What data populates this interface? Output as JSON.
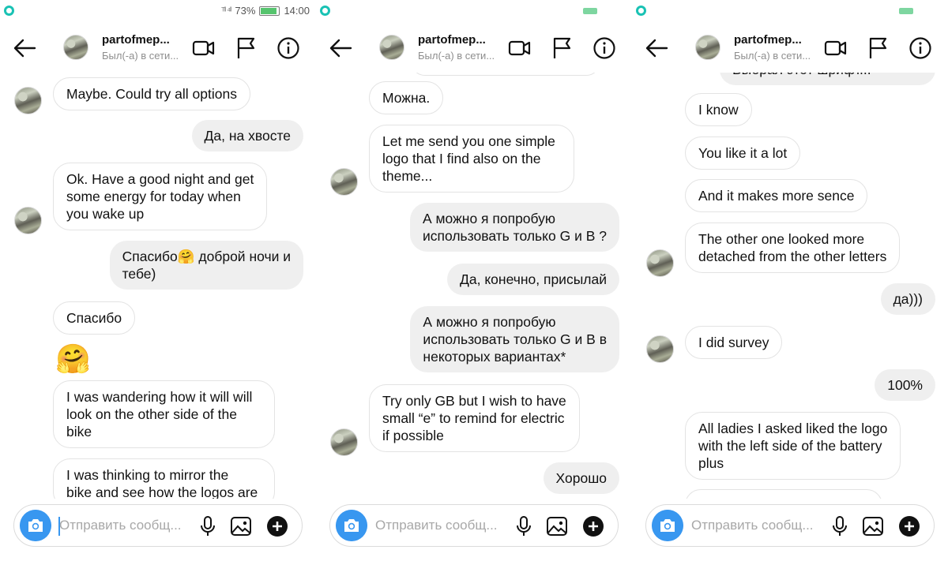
{
  "status": {
    "battery_pct": "73%",
    "time": "14:00"
  },
  "header": {
    "name": "partofmep...",
    "status": "Был(-а) в сети..."
  },
  "composer": {
    "placeholder": "Отправить сообщ..."
  },
  "panel1": {
    "messages": [
      {
        "text": "Maybe. Could try all options"
      },
      {
        "text": "Да, на хвосте"
      },
      {
        "text": "Ok. Have a good night and get\nsome energy for today when\nyou wake up"
      },
      {
        "text": "Спасибо🤗 доброй ночи и\nтебе)"
      },
      {
        "text": "Спасибо"
      },
      {
        "text": "🤗"
      },
      {
        "text": "I was wandering how it will will\nlook on the other side of the\nbike"
      },
      {
        "text": "I was thinking to mirror the\nbike and see how the logos are"
      }
    ]
  },
  "panel2": {
    "messages": [
      {
        "text": "Можна."
      },
      {
        "text": "Let me send you one simple\nlogo that I find also on the\ntheme..."
      },
      {
        "text": "А можно я попробую\nиспользовать только G и B ?"
      },
      {
        "text": "Да, конечно, присылай"
      },
      {
        "text": "А можно я попробую\nиспользовать только G и B в\nнекоторых вариантах*"
      },
      {
        "text": "Try only GB but I wish to have\nsmall “e” to remind for electric\nif possible"
      },
      {
        "text": "Хорошо"
      }
    ]
  },
  "panel3": {
    "messages": [
      {
        "text": "Выбрал этот шрифт..."
      },
      {
        "text": "I know"
      },
      {
        "text": "You like it a lot"
      },
      {
        "text": "And it makes more sence"
      },
      {
        "text": "The other one looked more\ndetached from the other letters"
      },
      {
        "text": "да)))"
      },
      {
        "text": "I did survey"
      },
      {
        "text": "100%"
      },
      {
        "text": "All ladies I asked liked the logo\nwith the left side of the battery\nplus"
      }
    ]
  }
}
